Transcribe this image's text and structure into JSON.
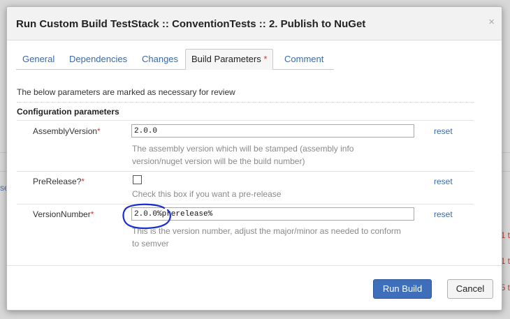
{
  "dialog": {
    "title": "Run Custom Build TestStack :: ConventionTests :: 2. Publish to NuGet",
    "close_glyph": "×"
  },
  "tabs": [
    {
      "label": "General",
      "active": false
    },
    {
      "label": "Dependencies",
      "active": false
    },
    {
      "label": "Changes",
      "active": false
    },
    {
      "label": "Build Parameters",
      "active": true,
      "marker": "*"
    },
    {
      "label": "Comment",
      "active": false
    }
  ],
  "notice": "The below parameters are marked as necessary for review",
  "section": {
    "title": "Configuration parameters"
  },
  "params": [
    {
      "label": "AssemblyVersion",
      "required": "*",
      "type": "text",
      "value": "2.0.0",
      "description_lines": [
        "The assembly version which will be stamped (assembly info",
        "version/nuget version will be the build number)"
      ],
      "reset": "reset"
    },
    {
      "label": "PreRelease?",
      "required": "*",
      "type": "checkbox",
      "checked": false,
      "description_lines": [
        "Check this box if you want a pre-release"
      ],
      "reset": "reset"
    },
    {
      "label": "VersionNumber",
      "required": "*",
      "type": "text",
      "value": "2.0.0%prerelease%",
      "description_lines": [
        "This is the version number, adjust the major/minor as needed to conform",
        "to semver"
      ],
      "reset": "reset"
    }
  ],
  "buttons": {
    "run": "Run Build",
    "cancel": "Cancel"
  },
  "colors": {
    "accent": "#3f6fbb",
    "required": "#d9352b",
    "link": "#3a6aa8",
    "annotation": "#1a2fd0"
  },
  "background": {
    "left_text": "se",
    "red_texts": [
      "1 t",
      "1 t",
      "5 t"
    ]
  }
}
